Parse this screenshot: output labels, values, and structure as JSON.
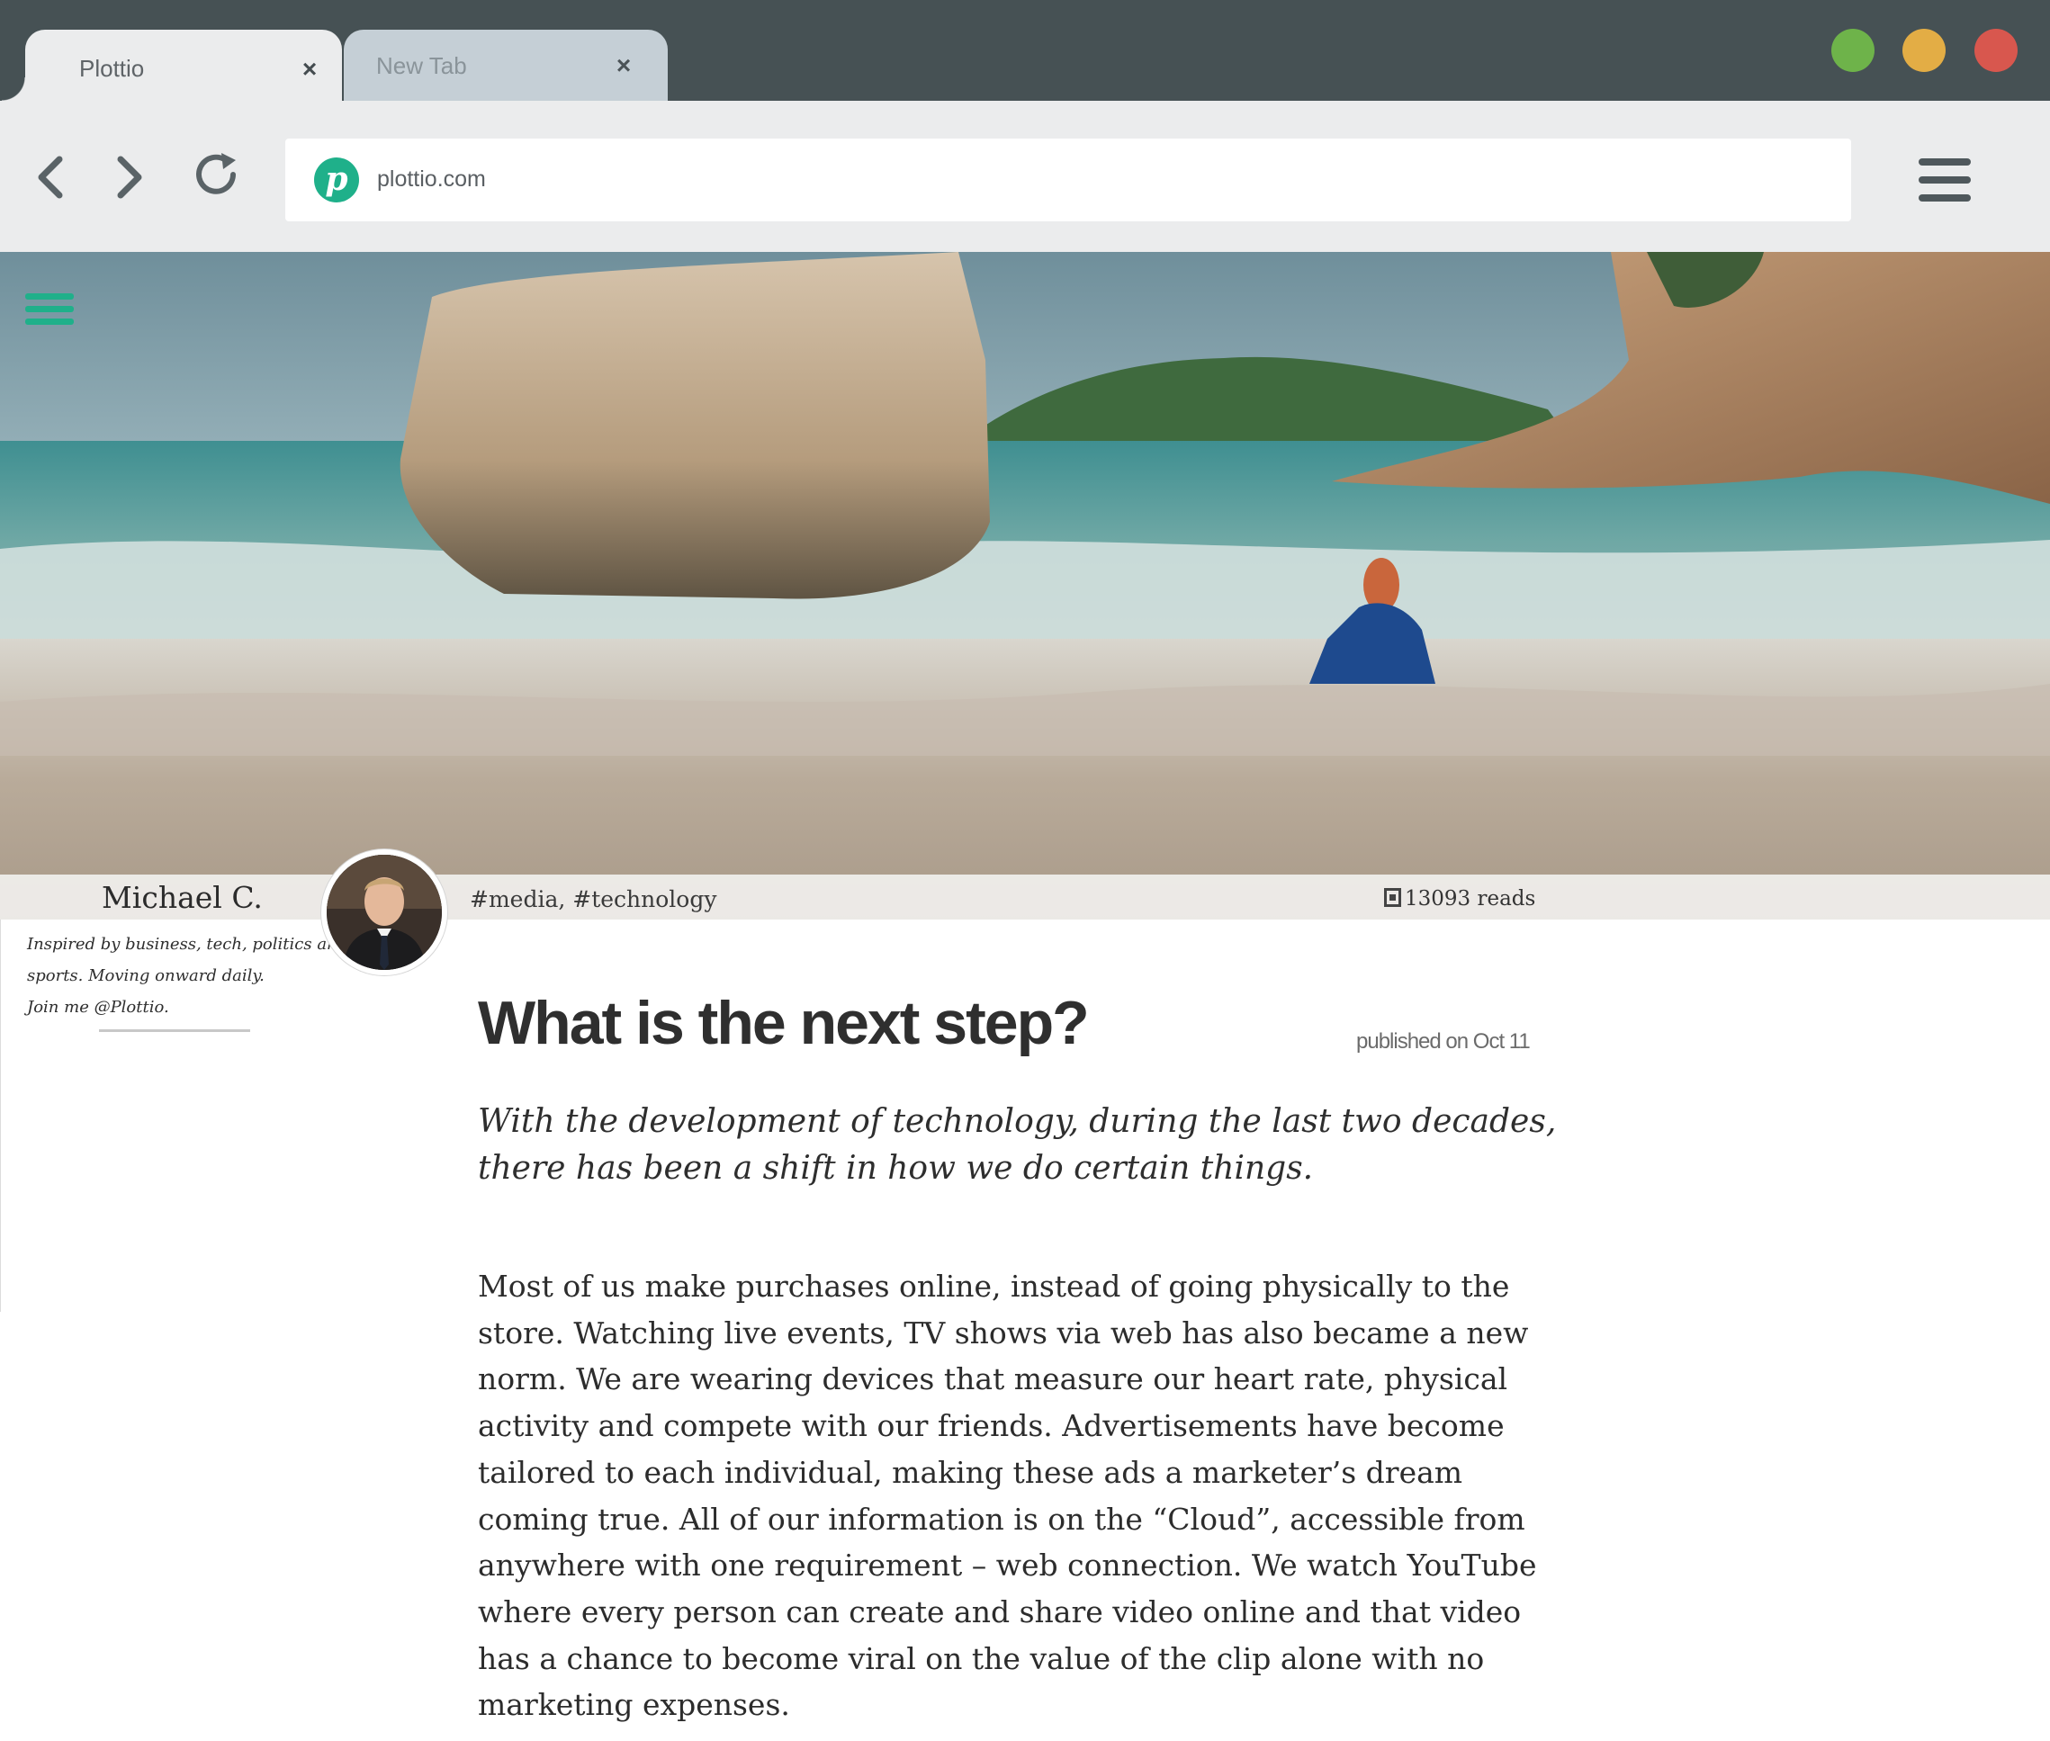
{
  "browser": {
    "tabs": [
      {
        "label": "Plottio",
        "close": "×"
      },
      {
        "label": "New Tab",
        "close": "×"
      }
    ],
    "address": {
      "url": "plottio.com",
      "logo_letter": "p"
    },
    "colors": {
      "titlebar": "#465154",
      "toolbar": "#ebeced",
      "accent": "#1fb08a",
      "light_green": "#6eb34a",
      "light_yellow": "#e3ad45",
      "light_red": "#d8574e"
    }
  },
  "article": {
    "author": {
      "name": "Michael C.",
      "bio_lines": [
        "Inspired by business, tech, politics and",
        "sports. Moving onward daily.",
        "Join me @Plottio."
      ]
    },
    "tags": "#media, #technology",
    "reads": "13093 reads",
    "title": "What is the next step?",
    "published": "published on Oct 11",
    "lead_lines": [
      "With the development of technology, during the last two decades,",
      "there has been a shift in how we do certain things."
    ],
    "body_lines": [
      "Most of us make purchases online, instead of going physically to the",
      "store. Watching live events, TV shows via web has also became a new",
      "norm. We are wearing devices that measure our heart rate, physical",
      "activity and compete with our friends. Advertisements have become",
      "tailored to each individual, making these ads a marketer’s dream",
      "coming true. All of our information is on the “Cloud”, accessible from",
      "anywhere with one requirement – web connection. We watch YouTube",
      "where every person can create and share video online and that video",
      "has a chance to become viral on the value of the clip alone with no",
      "marketing expenses."
    ]
  }
}
